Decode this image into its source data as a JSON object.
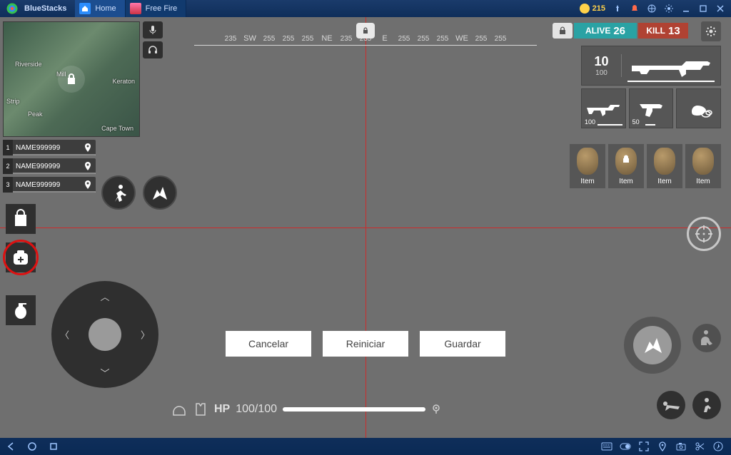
{
  "bluestacks": {
    "title": "BlueStacks",
    "coins": "215",
    "tabs": [
      {
        "label": "Home"
      },
      {
        "label": "Free Fire"
      }
    ]
  },
  "compass": {
    "segments": [
      "235",
      "SW",
      "255",
      "255",
      "255",
      "NE",
      "235",
      "235",
      "E",
      "255",
      "255",
      "255",
      "WE",
      "255",
      "255"
    ]
  },
  "hud": {
    "alive_label": "ALIVE",
    "alive_value": "26",
    "kill_label": "KILL",
    "kill_value": "13"
  },
  "weapon": {
    "current_ammo": "10",
    "total_ammo": "100",
    "secondary_ammo": "100",
    "pistol_ammo": "50"
  },
  "items": {
    "label": "Item"
  },
  "teammates": [
    {
      "index": "1",
      "name": "NAME999999"
    },
    {
      "index": "2",
      "name": "NAME999999"
    },
    {
      "index": "3",
      "name": "NAME999999"
    }
  ],
  "hp": {
    "prefix": "HP",
    "value": "100/100"
  },
  "dialog": {
    "cancel": "Cancelar",
    "reset": "Reiniciar",
    "save": "Guardar"
  },
  "minimap_labels": {
    "riverside": "Riverside",
    "strip": "Strip",
    "peak": "Peak",
    "keraton": "Keraton",
    "capetown": "Cape Town",
    "mill": "Mill"
  }
}
